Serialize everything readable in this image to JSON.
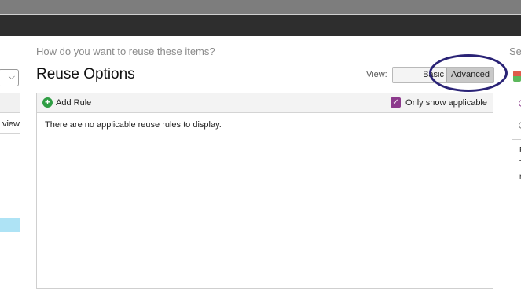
{
  "left_panel": {
    "column_fragment": "view",
    "select_chevron": "chevron-down-icon"
  },
  "main": {
    "question": "How do you want to reuse these items?",
    "title": "Reuse Options",
    "view": {
      "label": "View:",
      "options": [
        "Basic",
        "Advanced"
      ],
      "selected": "Advanced"
    },
    "toolbar": {
      "add_rule_label": "Add Rule",
      "add_icon": "plus-circle-icon",
      "only_applicable_label": "Only show applicable",
      "only_applicable_checked": true
    },
    "empty_message": "There are no applicable reuse rules to display."
  },
  "right_panel": {
    "heading_fragment": "Se",
    "text_fragments": [
      "F",
      "T",
      "r"
    ]
  },
  "colors": {
    "topbar": "#2e2e2e",
    "accent_checkbox": "#8c3a8c",
    "add_icon": "#2f9e44",
    "annotation_ellipse": "#2a2376",
    "selected_row": "#aee3f5"
  }
}
